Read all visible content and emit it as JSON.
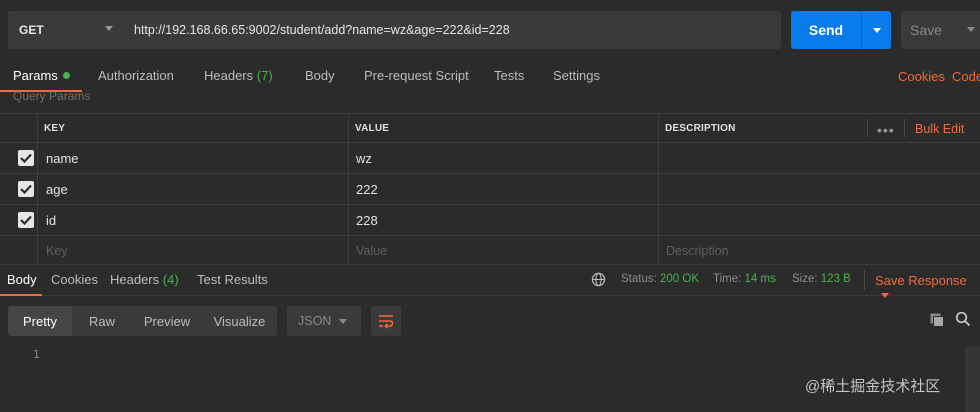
{
  "request": {
    "method": "GET",
    "url": "http://192.168.66.65:9002/student/add?name=wz&age=222&id=228",
    "send_label": "Send",
    "save_label": "Save"
  },
  "request_tabs": [
    {
      "label": "Params",
      "active": true,
      "has_dot": true
    },
    {
      "label": "Authorization"
    },
    {
      "label": "Headers",
      "count": "(7)"
    },
    {
      "label": "Body"
    },
    {
      "label": "Pre-request Script"
    },
    {
      "label": "Tests"
    },
    {
      "label": "Settings"
    }
  ],
  "right_links": {
    "cookies": "Cookies",
    "code": "Code"
  },
  "query_params": {
    "title": "Query Params",
    "columns": {
      "key": "KEY",
      "value": "VALUE",
      "description": "DESCRIPTION"
    },
    "more_glyph": "•••",
    "bulk_edit": "Bulk Edit",
    "rows": [
      {
        "key": "name",
        "value": "wz",
        "checked": true
      },
      {
        "key": "age",
        "value": "222",
        "checked": true
      },
      {
        "key": "id",
        "value": "228",
        "checked": true
      }
    ],
    "placeholders": {
      "key": "Key",
      "value": "Value",
      "description": "Description"
    }
  },
  "response": {
    "tabs": [
      {
        "label": "Body",
        "active": true
      },
      {
        "label": "Cookies"
      },
      {
        "label": "Headers",
        "count": "(4)"
      },
      {
        "label": "Test Results"
      }
    ],
    "status_label": "Status:",
    "status_value": "200 OK",
    "time_label": "Time:",
    "time_value": "14 ms",
    "size_label": "Size:",
    "size_value": "123 B",
    "save_response": "Save Response",
    "view_modes": [
      "Pretty",
      "Raw",
      "Preview",
      "Visualize"
    ],
    "format": "JSON",
    "line_numbers": [
      "1"
    ]
  },
  "watermark": "@稀土掘金技术社区",
  "colors": {
    "accent": "#f26b3a",
    "send": "#097bed",
    "ok": "#4cb050",
    "bg": "#2b2b2b"
  }
}
